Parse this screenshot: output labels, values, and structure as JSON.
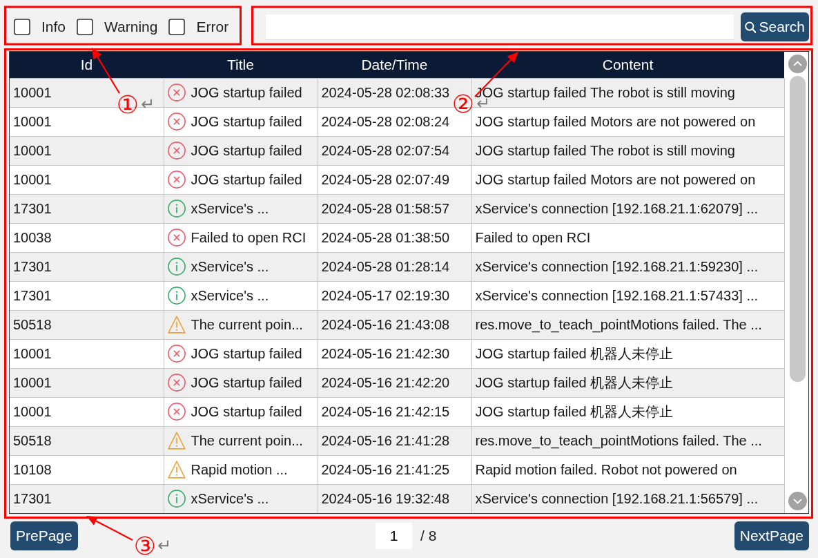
{
  "filters": [
    {
      "label": "Info",
      "checked": false
    },
    {
      "label": "Warning",
      "checked": false
    },
    {
      "label": "Error",
      "checked": false
    }
  ],
  "search": {
    "button": "Search"
  },
  "table": {
    "columns": [
      "Id",
      "Title",
      "Date/Time",
      "Content"
    ],
    "rows": [
      {
        "id": "10001",
        "kind": "error",
        "title": "JOG startup failed",
        "datetime": "2024-05-28 02:08:33",
        "content": "JOG startup failed The robot is still moving"
      },
      {
        "id": "10001",
        "kind": "error",
        "title": "JOG startup failed",
        "datetime": "2024-05-28 02:08:24",
        "content": "JOG startup failed Motors are not powered on"
      },
      {
        "id": "10001",
        "kind": "error",
        "title": "JOG startup failed",
        "datetime": "2024-05-28 02:07:54",
        "content": "JOG startup failed The robot is still moving"
      },
      {
        "id": "10001",
        "kind": "error",
        "title": "JOG startup failed",
        "datetime": "2024-05-28 02:07:49",
        "content": "JOG startup failed Motors are not powered on"
      },
      {
        "id": "17301",
        "kind": "info",
        "title": "xService's ...",
        "datetime": "2024-05-28 01:58:57",
        "content": "xService's connection [192.168.21.1:62079] ..."
      },
      {
        "id": "10038",
        "kind": "error",
        "title": "Failed to open RCI",
        "datetime": "2024-05-28 01:38:50",
        "content": "Failed to open RCI"
      },
      {
        "id": "17301",
        "kind": "info",
        "title": "xService's ...",
        "datetime": "2024-05-28 01:28:14",
        "content": "xService's connection [192.168.21.1:59230] ..."
      },
      {
        "id": "17301",
        "kind": "info",
        "title": "xService's ...",
        "datetime": "2024-05-17 02:19:30",
        "content": "xService's connection [192.168.21.1:57433] ..."
      },
      {
        "id": "50518",
        "kind": "warning",
        "title": "The current poin...",
        "datetime": "2024-05-16 21:43:08",
        "content": "res.move_to_teach_pointMotions failed. The ..."
      },
      {
        "id": "10001",
        "kind": "error",
        "title": "JOG startup failed",
        "datetime": "2024-05-16 21:42:30",
        "content": "JOG startup failed 机器人未停止"
      },
      {
        "id": "10001",
        "kind": "error",
        "title": "JOG startup failed",
        "datetime": "2024-05-16 21:42:20",
        "content": "JOG startup failed 机器人未停止"
      },
      {
        "id": "10001",
        "kind": "error",
        "title": "JOG startup failed",
        "datetime": "2024-05-16 21:42:15",
        "content": "JOG startup failed 机器人未停止"
      },
      {
        "id": "50518",
        "kind": "warning",
        "title": "The current poin...",
        "datetime": "2024-05-16 21:41:28",
        "content": "res.move_to_teach_pointMotions failed. The ..."
      },
      {
        "id": "10108",
        "kind": "warning",
        "title": "Rapid motion ...",
        "datetime": "2024-05-16 21:41:25",
        "content": "Rapid motion failed. Robot not powered on"
      },
      {
        "id": "17301",
        "kind": "info",
        "title": "xService's ...",
        "datetime": "2024-05-16 19:32:48",
        "content": "xService's connection [192.168.21.1:56579] ..."
      }
    ]
  },
  "pagination": {
    "previous": "PrePage",
    "page": "1",
    "total": "/ 8",
    "next": "NextPage"
  },
  "annotations": [
    {
      "number": "①",
      "mark": "↵"
    },
    {
      "number": "②",
      "mark": "↵"
    },
    {
      "number": "③",
      "mark": "↵"
    }
  ]
}
